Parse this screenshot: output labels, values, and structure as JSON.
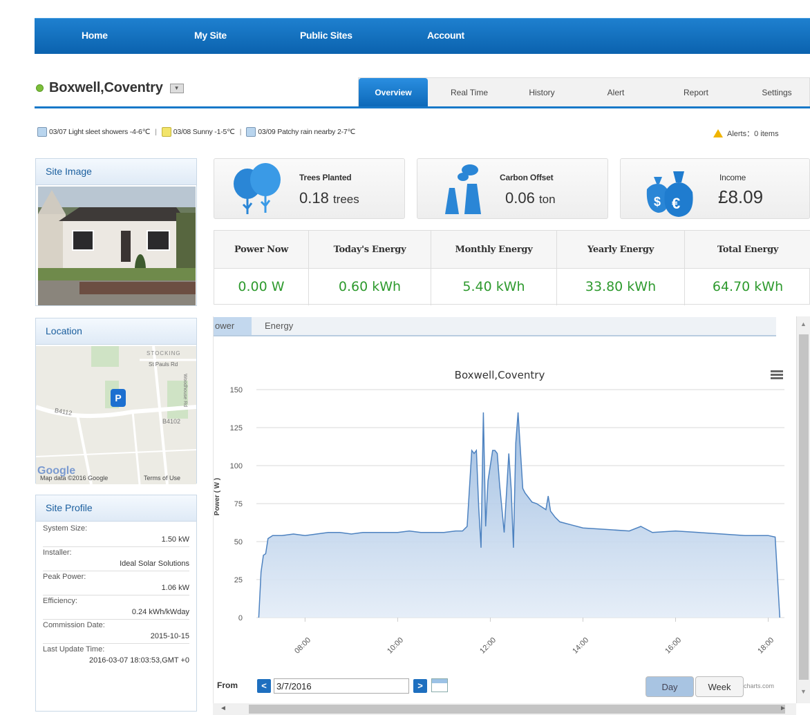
{
  "nav": {
    "items": [
      "Home",
      "My Site",
      "Public Sites",
      "Account"
    ]
  },
  "site": {
    "name": "Boxwell,Coventry",
    "dropdown_icon": "dropdown-arrow-icon"
  },
  "tabs": [
    "Overview",
    "Real Time",
    "History",
    "Alert",
    "Report",
    "Settings"
  ],
  "weather": [
    {
      "icon": "cloud-rain-icon",
      "text": "03/07 Light sleet showers -4-6℃"
    },
    {
      "icon": "sun-icon",
      "text": "03/08 Sunny -1-5℃"
    },
    {
      "icon": "cloud-rain-icon",
      "text": "03/09 Patchy rain nearby 2-7℃"
    }
  ],
  "alerts": {
    "text": "Alerts：0  items"
  },
  "site_image": {
    "title": "Site Image"
  },
  "location": {
    "title": "Location",
    "labels": {
      "area": "STOCKING",
      "street": "St Pauls Rd",
      "road1": "B4112",
      "road2": "B4102",
      "road3": "Woodhouse Rd",
      "logo": "Google",
      "copyright": "Map data ©2016 Google",
      "terms": "Terms of Use"
    }
  },
  "profile": {
    "title": "Site Profile",
    "rows": [
      {
        "label": "System Size:",
        "value": "1.50 kW"
      },
      {
        "label": "Installer:",
        "value": "Ideal Solar Solutions"
      },
      {
        "label": "Peak Power:",
        "value": "1.06 kW"
      },
      {
        "label": "Efficiency:",
        "value": "0.24 kWh/kWday"
      },
      {
        "label": "Commission Date:",
        "value": "2015-10-15"
      },
      {
        "label": "Last Update Time:",
        "value": "2016-03-07 18:03:53,GMT +0"
      }
    ]
  },
  "cards": {
    "trees": {
      "label": "Trees Planted",
      "value": "0.18",
      "unit": "trees"
    },
    "carbon": {
      "label": "Carbon Offset",
      "value": "0.06",
      "unit": "ton"
    },
    "income": {
      "label": "Income",
      "value": "£8.09"
    }
  },
  "energy": [
    {
      "label": "Power Now",
      "value": "0.00 W"
    },
    {
      "label": "Today's Energy",
      "value": "0.60 kWh"
    },
    {
      "label": "Monthly Energy",
      "value": "5.40 kWh"
    },
    {
      "label": "Yearly Energy",
      "value": "33.80 kWh"
    },
    {
      "label": "Total Energy",
      "value": "64.70 kWh"
    }
  ],
  "chart_tabs": [
    "ower",
    "Energy"
  ],
  "controls": {
    "from_label": "From",
    "date": "3/7/2016",
    "day": "Day",
    "week": "Week",
    "credit": "charts.com"
  },
  "colors": {
    "nav": "#0b62ae",
    "accent": "#1778c8",
    "value_green": "#2e9a2e",
    "area_fill": "#a9c4e4",
    "area_line": "#4d82c0"
  },
  "chart_data": {
    "type": "area",
    "title": "Boxwell,Coventry",
    "ylabel": "Power ( W )",
    "ylim": [
      0,
      150
    ],
    "yticks": [
      0,
      25,
      50,
      75,
      100,
      125,
      150
    ],
    "xticks": [
      "08:00",
      "10:00",
      "12:00",
      "14:00",
      "16:00",
      "18:00"
    ],
    "xlim": [
      6.95,
      18.35
    ],
    "grid": true,
    "series": [
      {
        "x": [
          7.0,
          7.05,
          7.1,
          7.15,
          7.2,
          7.3,
          7.5,
          7.75,
          8.0,
          8.25,
          8.5,
          8.75,
          9.0,
          9.25,
          9.5,
          9.75,
          10.0,
          10.25,
          10.5,
          10.75,
          11.0,
          11.25,
          11.4,
          11.5,
          11.6,
          11.65,
          11.7,
          11.75,
          11.8,
          11.85,
          11.9,
          11.95,
          12.05,
          12.1,
          12.15,
          12.2,
          12.3,
          12.4,
          12.45,
          12.5,
          12.55,
          12.6,
          12.7,
          12.75,
          12.8,
          12.9,
          13.0,
          13.1,
          13.2,
          13.25,
          13.3,
          13.4,
          13.5,
          13.75,
          14.0,
          14.5,
          15.0,
          15.25,
          15.5,
          16.0,
          16.5,
          17.0,
          17.5,
          18.0,
          18.15,
          18.25
        ],
        "y": [
          0,
          30,
          41,
          42,
          52,
          54,
          54,
          55,
          54,
          55,
          56,
          56,
          55,
          56,
          56,
          56,
          56,
          57,
          56,
          56,
          56,
          57,
          57,
          60,
          110,
          108,
          110,
          72,
          46,
          135,
          60,
          90,
          110,
          110,
          108,
          88,
          56,
          108,
          85,
          46,
          115,
          135,
          85,
          82,
          80,
          76,
          75,
          73,
          71,
          80,
          70,
          66,
          63,
          61,
          59,
          58,
          57,
          60,
          56,
          57,
          56,
          55,
          54,
          54,
          53,
          0
        ]
      }
    ]
  }
}
